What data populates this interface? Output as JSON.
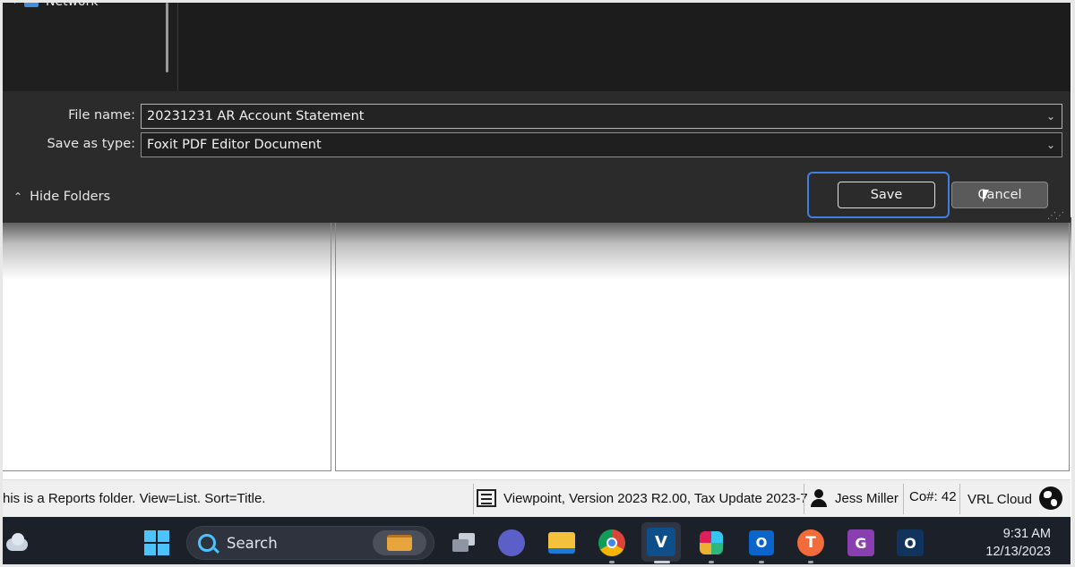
{
  "dialog": {
    "nav_item_label": "Network",
    "file_name_label": "File name:",
    "file_name_value": "20231231 AR Account Statement",
    "save_type_label": "Save as type:",
    "save_type_value": "Foxit PDF Editor Document",
    "hide_folders_label": "Hide Folders",
    "save_label": "Save",
    "cancel_label": "Cancel"
  },
  "statusbar": {
    "folder_info": "his is a Reports folder. View=List. Sort=Title.",
    "version": "Viewpoint, Version 2023 R2.00, Tax Update 2023-7",
    "user": "Jess Miller",
    "company": "Co#: 42",
    "cloud": "VRL Cloud"
  },
  "taskbar": {
    "search_label": "Search",
    "apps": [
      {
        "name": "task-view",
        "glyph": ""
      },
      {
        "name": "meet",
        "glyph": ""
      },
      {
        "name": "file-explorer",
        "glyph": ""
      },
      {
        "name": "chrome",
        "glyph": ""
      },
      {
        "name": "viewpoint",
        "glyph": "V"
      },
      {
        "name": "slack",
        "glyph": ""
      },
      {
        "name": "outlook-new",
        "glyph": "O"
      },
      {
        "name": "tool-t",
        "glyph": "T"
      },
      {
        "name": "foxit-pdf",
        "glyph": "G"
      },
      {
        "name": "app-o",
        "glyph": "O"
      }
    ],
    "time": "9:31 AM",
    "date": "12/13/2023"
  },
  "colors": {
    "accent_focus": "#3f7fe0",
    "windows_blue": "#4cc2ff",
    "dialog_bg": "#2b2b2b",
    "taskbar_bg": "#1c2028"
  }
}
